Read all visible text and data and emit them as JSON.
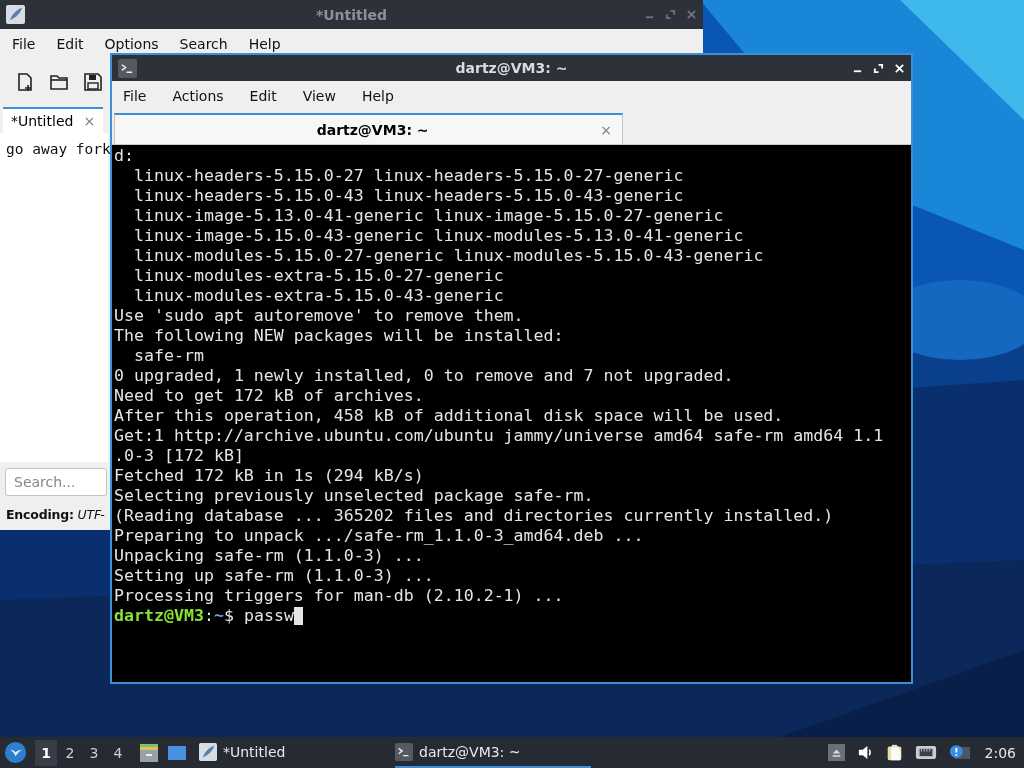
{
  "editor": {
    "title": "*Untitled",
    "menu": [
      "File",
      "Edit",
      "Options",
      "Search",
      "Help"
    ],
    "tabs": [
      {
        "label": "*Untitled",
        "close": "×",
        "selected": true
      }
    ],
    "text": "go away fork",
    "search": {
      "placeholder": "Search..."
    },
    "status": {
      "label": "Encoding:",
      "value": "UTF-"
    }
  },
  "terminal": {
    "title": "dartz@VM3: ~",
    "menu": [
      "File",
      "Actions",
      "Edit",
      "View",
      "Help"
    ],
    "tabs": [
      {
        "label": "dartz@VM3: ~",
        "close": "×",
        "selected": true
      }
    ],
    "lines": [
      "d:",
      "  linux-headers-5.15.0-27 linux-headers-5.15.0-27-generic",
      "  linux-headers-5.15.0-43 linux-headers-5.15.0-43-generic",
      "  linux-image-5.13.0-41-generic linux-image-5.15.0-27-generic",
      "  linux-image-5.15.0-43-generic linux-modules-5.13.0-41-generic",
      "  linux-modules-5.15.0-27-generic linux-modules-5.15.0-43-generic",
      "  linux-modules-extra-5.15.0-27-generic",
      "  linux-modules-extra-5.15.0-43-generic",
      "Use 'sudo apt autoremove' to remove them.",
      "The following NEW packages will be installed:",
      "  safe-rm",
      "0 upgraded, 1 newly installed, 0 to remove and 7 not upgraded.",
      "Need to get 172 kB of archives.",
      "After this operation, 458 kB of additional disk space will be used.",
      "Get:1 http://archive.ubuntu.com/ubuntu jammy/universe amd64 safe-rm amd64 1.1",
      ".0-3 [172 kB]",
      "Fetched 172 kB in 1s (294 kB/s)",
      "Selecting previously unselected package safe-rm.",
      "(Reading database ... 365202 files and directories currently installed.)",
      "Preparing to unpack .../safe-rm_1.1.0-3_amd64.deb ...",
      "Unpacking safe-rm (1.1.0-3) ...",
      "Setting up safe-rm (1.1.0-3) ...",
      "Processing triggers for man-db (2.10.2-1) ..."
    ],
    "prompt": {
      "user": "dartz@VM3",
      "sep": ":",
      "path": "~",
      "symbol": "$",
      "input": "passw"
    }
  },
  "taskbar": {
    "workspaces": [
      {
        "label": "1",
        "selected": true
      },
      {
        "label": "2",
        "selected": false
      },
      {
        "label": "3",
        "selected": false
      },
      {
        "label": "4",
        "selected": false
      }
    ],
    "tasks": [
      {
        "kind": "editor",
        "label": "*Untitled",
        "selected": false
      },
      {
        "kind": "terminal",
        "label": "dartz@VM3: ~",
        "selected": true
      }
    ],
    "clock": "2:06"
  }
}
